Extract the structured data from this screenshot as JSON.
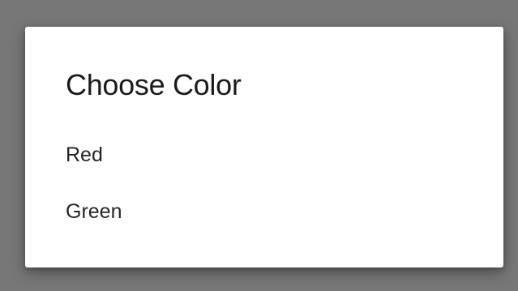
{
  "dialog": {
    "title": "Choose Color",
    "options": [
      {
        "label": "Red"
      },
      {
        "label": "Green"
      }
    ]
  },
  "colors": {
    "scrim": "#777777",
    "surface": "#ffffff",
    "title_text": "#1c1c1c",
    "option_text": "#262626"
  }
}
